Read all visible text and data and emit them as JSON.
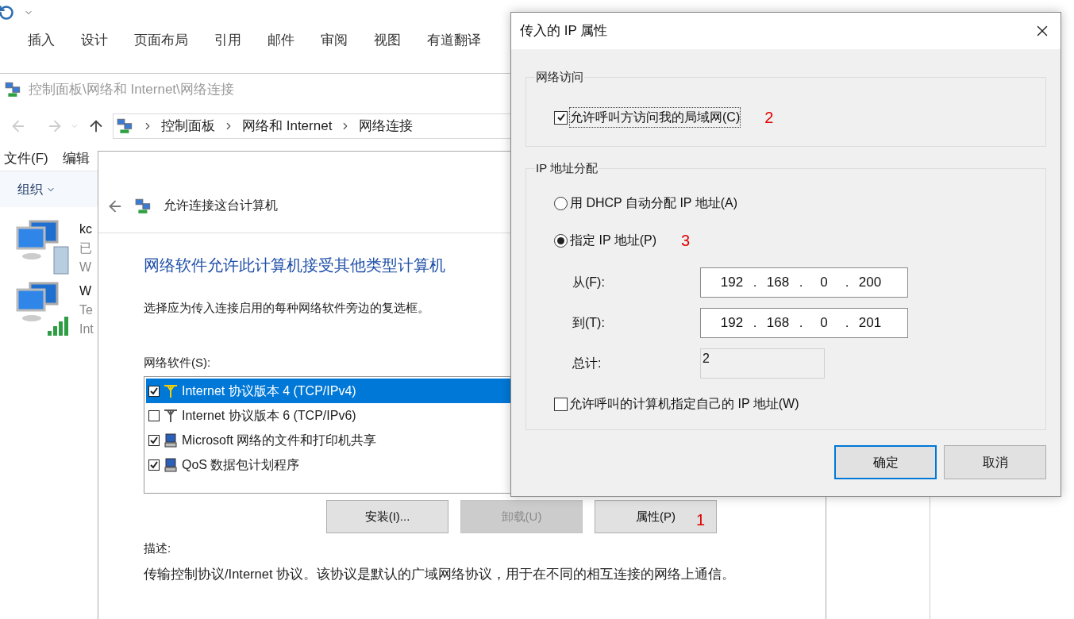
{
  "word": {
    "ribbon_tabs": [
      "插入",
      "设计",
      "页面布局",
      "引用",
      "邮件",
      "审阅",
      "视图",
      "有道翻译"
    ]
  },
  "explorer": {
    "title": "控制面板\\网络和 Internet\\网络连接",
    "breadcrumbs": [
      "控制面板",
      "网络和 Internet",
      "网络连接"
    ],
    "menu": [
      "文件(F)",
      "编辑"
    ],
    "toolbar": {
      "organize": "组织"
    },
    "connections": [
      {
        "kind": "wired",
        "name": "kc",
        "lines": [
          "已",
          "W"
        ]
      },
      {
        "kind": "wifi",
        "name": "W",
        "lines": [
          "Te",
          "Int"
        ]
      }
    ]
  },
  "wizard": {
    "title": "允许连接这台计算机",
    "heading": "网络软件允许此计算机接受其他类型计算机",
    "instruction": "选择应为传入连接启用的每种网络软件旁边的复选框。",
    "list_label": "网络软件(S):",
    "software": [
      {
        "kind": "protocol",
        "label": "Internet 协议版本 4 (TCP/IPv4)",
        "checked": true,
        "selected": true
      },
      {
        "kind": "protocol",
        "label": "Internet 协议版本 6 (TCP/IPv6)",
        "checked": false,
        "selected": false
      },
      {
        "kind": "service",
        "label": "Microsoft 网络的文件和打印机共享",
        "checked": true,
        "selected": false
      },
      {
        "kind": "service",
        "label": "QoS 数据包计划程序",
        "checked": true,
        "selected": false
      }
    ],
    "buttons": [
      {
        "label": "安装(I)...",
        "disabled": false
      },
      {
        "label": "卸载(U)",
        "disabled": true
      },
      {
        "label": "属性(P)",
        "disabled": false,
        "annotation": "1"
      }
    ],
    "description_label": "描述:",
    "description": "传输控制协议/Internet 协议。该协议是默认的广域网络协议，用于在不同的相互连接的网络上通信。"
  },
  "dialog": {
    "title": "传入的 IP 属性",
    "network_access": {
      "legend": "网络访问",
      "checkbox": {
        "label": "允许呼叫方访问我的局域网(C)",
        "checked": true,
        "annotation": "2"
      }
    },
    "ip_assignment": {
      "legend": "IP 地址分配",
      "options": [
        {
          "label": "用 DHCP 自动分配 IP 地址(A)",
          "selected": false
        },
        {
          "label": "指定 IP 地址(P)",
          "selected": true,
          "annotation": "3"
        }
      ],
      "fields": [
        {
          "label": "从(F):",
          "octets": [
            "192",
            "168",
            "0",
            "200"
          ],
          "separator": "."
        },
        {
          "label": "到(T):",
          "octets": [
            "192",
            "168",
            "0",
            "201"
          ],
          "separator": "."
        }
      ],
      "total": {
        "label": "总计:",
        "value": "2"
      },
      "checkbox": {
        "label": "允许呼叫的计算机指定自己的 IP 地址(W)",
        "checked": false
      }
    },
    "buttons": [
      {
        "label": "确定",
        "default": true
      },
      {
        "label": "取消",
        "default": false
      }
    ]
  }
}
